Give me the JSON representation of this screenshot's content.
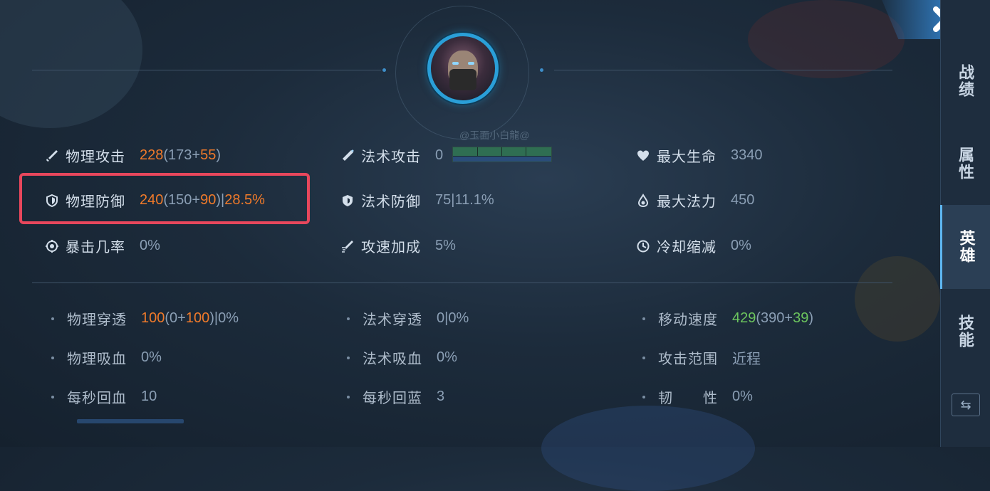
{
  "player": {
    "watermark": "@玉面小白龍@"
  },
  "core_stats": [
    {
      "icon": "sword-icon",
      "label": "物理攻击",
      "value": "228",
      "base": "(173+",
      "bonus": "55",
      "end": ")"
    },
    {
      "icon": "magic-wand-icon",
      "label": "法术攻击",
      "value": "0"
    },
    {
      "icon": "heart-icon",
      "label": "最大生命",
      "value": "3340"
    },
    {
      "icon": "shield-icon",
      "label": "物理防御",
      "value": "240",
      "base": "(150+",
      "bonus": "90",
      "end": ")|",
      "pct": "28.5%"
    },
    {
      "icon": "magic-shield-icon",
      "label": "法术防御",
      "value": "75|11.1%"
    },
    {
      "icon": "mana-drop-icon",
      "label": "最大法力",
      "value": "450"
    },
    {
      "icon": "crit-target-icon",
      "label": "暴击几率",
      "value": "0%"
    },
    {
      "icon": "attack-speed-icon",
      "label": "攻速加成",
      "value": "5%"
    },
    {
      "icon": "cooldown-clock-icon",
      "label": "冷却缩减",
      "value": "0%"
    }
  ],
  "sub_stats": [
    {
      "label": "物理穿透",
      "v1": "100",
      "v2": "(0+",
      "v3": "100",
      "v4": ")|0%"
    },
    {
      "label": "法术穿透",
      "value": "0|0%"
    },
    {
      "label": "移动速度",
      "v1": "429",
      "v2": "(390+",
      "v3": "39",
      "v4": ")"
    },
    {
      "label": "物理吸血",
      "value": "0%"
    },
    {
      "label": "法术吸血",
      "value": "0%"
    },
    {
      "label": "攻击范围",
      "value": "近程"
    },
    {
      "label": "每秒回血",
      "value": "10"
    },
    {
      "label": "每秒回蓝",
      "value": "3"
    },
    {
      "label": "韧　　性",
      "value": "0%"
    }
  ],
  "sidebar": {
    "tabs": [
      "战绩",
      "属性",
      "英雄",
      "技能"
    ],
    "active": "英雄",
    "swap_icon": "swap-icon"
  },
  "close_icon": "close-icon",
  "colors": {
    "orange": "#f07a2a",
    "green": "#6cc55e",
    "highlight": "#e8475c",
    "accent": "#2a9fd8"
  },
  "mana_bar_fraction": 0.0
}
